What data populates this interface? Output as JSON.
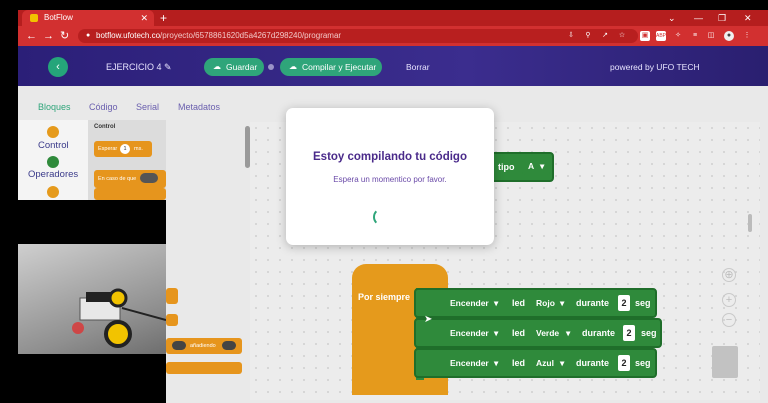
{
  "browser": {
    "tab_title": "BotFlow",
    "tab_close": "✕",
    "new_tab": "+",
    "url_host": "botflow.ufotech.co",
    "url_path": "/proyecto/6578861620d5a4267d298240/programar",
    "window_controls": {
      "minimize": "—",
      "maximize": "❐",
      "close": "✕",
      "chevron": "⌄"
    }
  },
  "header": {
    "back_icon": "‹",
    "exercise_name": "EJERCICIO 4 ✎",
    "save_label": "Guardar",
    "compile_label": "Compilar y Ejecutar",
    "delete_label": "Borrar",
    "powered_by": "powered by UFO TECH"
  },
  "tabs": {
    "bloques": "Bloques",
    "codigo": "Código",
    "serial": "Serial",
    "metadatos": "Metadatos"
  },
  "categories": {
    "control": "Control",
    "operadores": "Operadores"
  },
  "palette": {
    "header": "Control",
    "wait_block": "Esperar",
    "wait_value": "1",
    "wait_unit": "ms.",
    "case_block": "En caso de que",
    "pressed_block": "añadiendo"
  },
  "workspace": {
    "tipo_label": "tipo",
    "tipo_value": "A",
    "forever_label": "Por siempre",
    "rows": [
      {
        "action": "Encender",
        "led_label": "led",
        "color": "Rojo",
        "durante": "durante",
        "seconds": "2",
        "unit": "seg"
      },
      {
        "action": "Encender",
        "led_label": "led",
        "color": "Verde",
        "durante": "durante",
        "seconds": "2",
        "unit": "seg"
      },
      {
        "action": "Encender",
        "led_label": "led",
        "color": "Azul",
        "durante": "durante",
        "seconds": "2",
        "unit": "seg"
      }
    ]
  },
  "modal": {
    "title": "Estoy compilando tu código",
    "subtitle": "Espera un momentico por favor."
  },
  "colors": {
    "accent": "#2fa57a",
    "header_bg": "#2b1f78",
    "browser_red": "#d23030",
    "block_green": "#2f8a3b",
    "block_orange": "#e59a1c"
  }
}
